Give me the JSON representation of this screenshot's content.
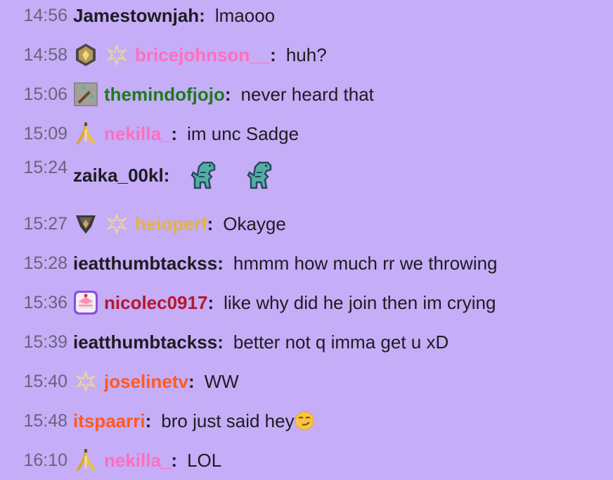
{
  "messages": [
    {
      "time": "14:56",
      "user": "Jamestownjah",
      "text": "lmaooo",
      "color": "#1d1c22"
    },
    {
      "time": "14:58",
      "user": "bricejohnson__",
      "text": "huh?",
      "color": "#ff6fbf",
      "badges": [
        "gold-rank-badge-icon",
        "sparkle-badge-icon"
      ]
    },
    {
      "time": "15:06",
      "user": "themindofjojo",
      "text": "never heard that",
      "color": "#1c7a1c",
      "badges": [
        "pickaxe-badge-icon"
      ]
    },
    {
      "time": "15:09",
      "user": "nekilla_",
      "text": "im unc Sadge",
      "color": "#ff6fbf",
      "badges": [
        "banana-badge-icon"
      ]
    },
    {
      "time": "15:24",
      "user": "zaika_00kl",
      "text": "",
      "color": "#1d1c22",
      "emotes": [
        "dino-emote-icon",
        "dino-emote-icon"
      ]
    },
    {
      "time": "15:27",
      "user": "heioperf",
      "text": "Okayge",
      "color": "#e6b33a",
      "badges": [
        "dark-rank-badge-icon",
        "sparkle-badge-icon"
      ]
    },
    {
      "time": "15:28",
      "user": "ieatthumbtackss",
      "text": "hmmm how much rr we throwing",
      "color": "#1d1c22"
    },
    {
      "time": "15:36",
      "user": "nicolec0917",
      "text": "like why did he join then im crying",
      "color": "#b5172e",
      "badges": [
        "cake-badge-icon"
      ]
    },
    {
      "time": "15:39",
      "user": "ieatthumbtackss",
      "text": "better not q imma get u xD",
      "color": "#1d1c22"
    },
    {
      "time": "15:40",
      "user": "joselinetv",
      "text": "WW",
      "color": "#ff5a1f",
      "badges": [
        "sparkle-badge-icon"
      ]
    },
    {
      "time": "15:48",
      "user": "itspaarri",
      "text": "bro just said hey",
      "color": "#ff5a1f",
      "emoji": "smirk-emoji-icon"
    },
    {
      "time": "16:10",
      "user": "nekilla_",
      "text": "LOL",
      "color": "#ff6fbf",
      "badges": [
        "banana-badge-icon"
      ]
    }
  ]
}
